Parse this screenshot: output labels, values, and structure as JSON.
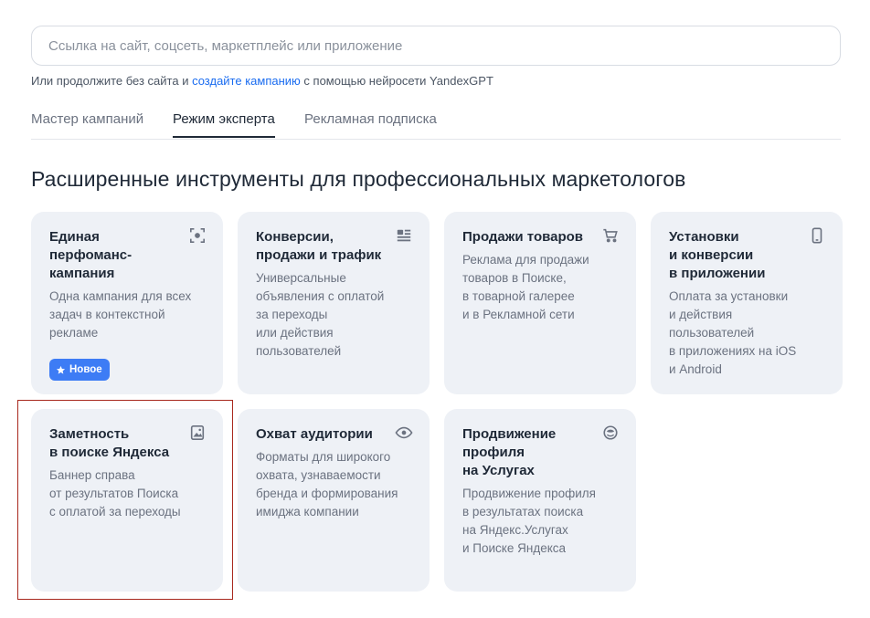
{
  "search": {
    "placeholder": "Ссылка на сайт, соцсеть, маркетплейс или приложение",
    "value": ""
  },
  "hint": {
    "prefix": "Или продолжите без сайта и ",
    "link": "создайте кампанию",
    "suffix": " с помощью нейросети YandexGPT"
  },
  "tabs": [
    {
      "label": "Мастер кампаний",
      "active": false
    },
    {
      "label": "Режим эксперта",
      "active": true
    },
    {
      "label": "Рекламная подписка",
      "active": false
    }
  ],
  "heading": "Расширенные инструменты для профессиональных маркетологов",
  "cards": [
    {
      "title": "Единая\nперфоманс-\nкампания",
      "description": "Одна кампания для всех\nзадач в контекстной\nрекламе",
      "icon": "focus-target-icon",
      "badge": "Новое"
    },
    {
      "title": "Конверсии,\nпродажи и трафик",
      "description": "Универсальные\nобъявления с оплатой\nза переходы\nили действия\nпользователей",
      "icon": "article-icon"
    },
    {
      "title": "Продажи товаров",
      "description": "Реклама для продажи\nтоваров в Поиске,\nв товарной галерее\nи в Рекламной сети",
      "icon": "cart-icon"
    },
    {
      "title": "Установки\nи конверсии\nв приложении",
      "description": "Оплата за установки\nи действия\nпользователей\nв приложениях на iOS\nи Android",
      "icon": "phone-icon"
    },
    {
      "title": "Заметность\nв поиске Яндекса",
      "description": "Баннер справа\nот результатов Поиска\nс оплатой за переходы",
      "icon": "image-icon"
    },
    {
      "title": "Охват аудитории",
      "description": "Форматы для широкого\nохвата, узнаваемости\nбренда и формирования\nимиджа компании",
      "icon": "eye-icon"
    },
    {
      "title": "Продвижение\nпрофиля\nна Услугах",
      "description": "Продвижение профиля\nв результатах поиска\nна Яндекс.Услугах\nи Поиске Яндекса",
      "icon": "services-icon"
    }
  ],
  "colors": {
    "accent": "#1a6cf0",
    "badge": "#3d7cf5",
    "card_bg": "#eef1f6",
    "highlight_border": "#a8281d"
  }
}
